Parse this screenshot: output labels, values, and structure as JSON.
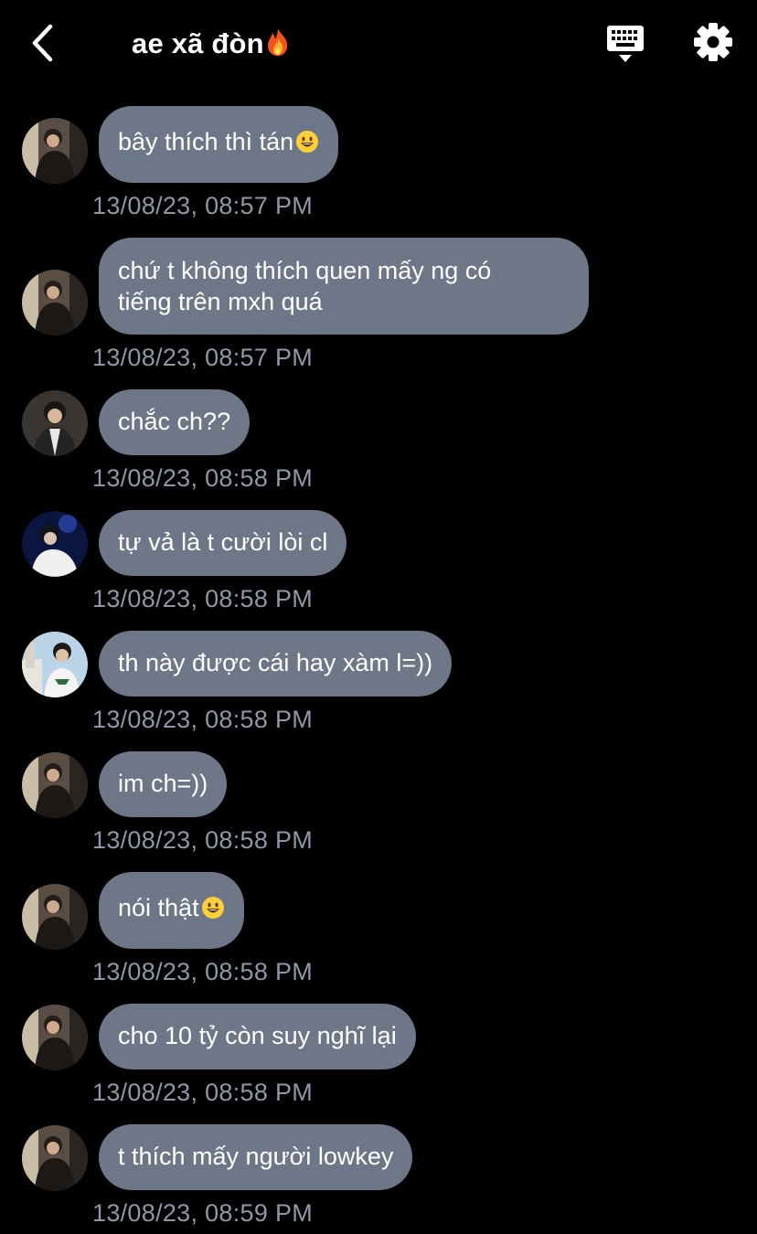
{
  "header": {
    "title": "ae xã đòn",
    "title_emoji_icon": "fire-icon",
    "back_icon": "chevron-left-icon",
    "keyboard_icon": "keyboard-icon",
    "settings_icon": "gear-icon"
  },
  "colors": {
    "background": "#000000",
    "bubble": "#6e7787",
    "timestamp": "#8e97a6",
    "text": "#ffffff"
  },
  "messages": [
    {
      "text": "bây thích thì tán",
      "emoji_icon": "grinning-face-icon",
      "time": "13/08/23, 08:57 PM"
    },
    {
      "lines": [
        "chứ t không thích quen mấy ng có",
        "tiếng trên mxh quá"
      ],
      "time": "13/08/23, 08:57 PM"
    },
    {
      "text": "chắc ch??",
      "time": "13/08/23, 08:58 PM"
    },
    {
      "text": "tự vả là t cười lòi cl",
      "time": "13/08/23, 08:58 PM"
    },
    {
      "text": "th này được cái hay xàm l=))",
      "time": "13/08/23, 08:58 PM"
    },
    {
      "text": "im ch=))",
      "time": "13/08/23, 08:58 PM"
    },
    {
      "text": "nói thật",
      "emoji_icon": "grinning-face-icon",
      "time": "13/08/23, 08:58 PM"
    },
    {
      "text": "cho 10 tỷ còn suy nghĩ lại",
      "time": "13/08/23, 08:58 PM"
    },
    {
      "text": "t thích mấy người lowkey",
      "time": "13/08/23, 08:59 PM"
    }
  ]
}
